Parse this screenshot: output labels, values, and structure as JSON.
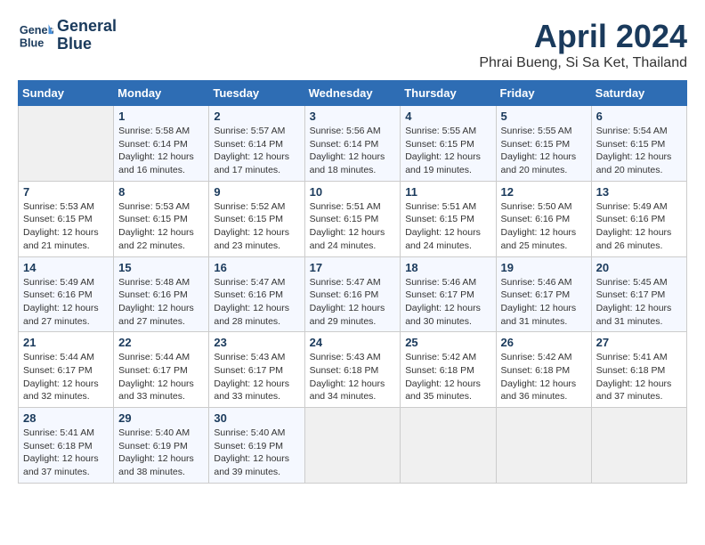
{
  "header": {
    "logo_line1": "General",
    "logo_line2": "Blue",
    "month": "April 2024",
    "location": "Phrai Bueng, Si Sa Ket, Thailand"
  },
  "weekdays": [
    "Sunday",
    "Monday",
    "Tuesday",
    "Wednesday",
    "Thursday",
    "Friday",
    "Saturday"
  ],
  "weeks": [
    [
      {
        "day": "",
        "sunrise": "",
        "sunset": "",
        "daylight": ""
      },
      {
        "day": "1",
        "sunrise": "Sunrise: 5:58 AM",
        "sunset": "Sunset: 6:14 PM",
        "daylight": "Daylight: 12 hours and 16 minutes."
      },
      {
        "day": "2",
        "sunrise": "Sunrise: 5:57 AM",
        "sunset": "Sunset: 6:14 PM",
        "daylight": "Daylight: 12 hours and 17 minutes."
      },
      {
        "day": "3",
        "sunrise": "Sunrise: 5:56 AM",
        "sunset": "Sunset: 6:14 PM",
        "daylight": "Daylight: 12 hours and 18 minutes."
      },
      {
        "day": "4",
        "sunrise": "Sunrise: 5:55 AM",
        "sunset": "Sunset: 6:15 PM",
        "daylight": "Daylight: 12 hours and 19 minutes."
      },
      {
        "day": "5",
        "sunrise": "Sunrise: 5:55 AM",
        "sunset": "Sunset: 6:15 PM",
        "daylight": "Daylight: 12 hours and 20 minutes."
      },
      {
        "day": "6",
        "sunrise": "Sunrise: 5:54 AM",
        "sunset": "Sunset: 6:15 PM",
        "daylight": "Daylight: 12 hours and 20 minutes."
      }
    ],
    [
      {
        "day": "7",
        "sunrise": "Sunrise: 5:53 AM",
        "sunset": "Sunset: 6:15 PM",
        "daylight": "Daylight: 12 hours and 21 minutes."
      },
      {
        "day": "8",
        "sunrise": "Sunrise: 5:53 AM",
        "sunset": "Sunset: 6:15 PM",
        "daylight": "Daylight: 12 hours and 22 minutes."
      },
      {
        "day": "9",
        "sunrise": "Sunrise: 5:52 AM",
        "sunset": "Sunset: 6:15 PM",
        "daylight": "Daylight: 12 hours and 23 minutes."
      },
      {
        "day": "10",
        "sunrise": "Sunrise: 5:51 AM",
        "sunset": "Sunset: 6:15 PM",
        "daylight": "Daylight: 12 hours and 24 minutes."
      },
      {
        "day": "11",
        "sunrise": "Sunrise: 5:51 AM",
        "sunset": "Sunset: 6:15 PM",
        "daylight": "Daylight: 12 hours and 24 minutes."
      },
      {
        "day": "12",
        "sunrise": "Sunrise: 5:50 AM",
        "sunset": "Sunset: 6:16 PM",
        "daylight": "Daylight: 12 hours and 25 minutes."
      },
      {
        "day": "13",
        "sunrise": "Sunrise: 5:49 AM",
        "sunset": "Sunset: 6:16 PM",
        "daylight": "Daylight: 12 hours and 26 minutes."
      }
    ],
    [
      {
        "day": "14",
        "sunrise": "Sunrise: 5:49 AM",
        "sunset": "Sunset: 6:16 PM",
        "daylight": "Daylight: 12 hours and 27 minutes."
      },
      {
        "day": "15",
        "sunrise": "Sunrise: 5:48 AM",
        "sunset": "Sunset: 6:16 PM",
        "daylight": "Daylight: 12 hours and 27 minutes."
      },
      {
        "day": "16",
        "sunrise": "Sunrise: 5:47 AM",
        "sunset": "Sunset: 6:16 PM",
        "daylight": "Daylight: 12 hours and 28 minutes."
      },
      {
        "day": "17",
        "sunrise": "Sunrise: 5:47 AM",
        "sunset": "Sunset: 6:16 PM",
        "daylight": "Daylight: 12 hours and 29 minutes."
      },
      {
        "day": "18",
        "sunrise": "Sunrise: 5:46 AM",
        "sunset": "Sunset: 6:17 PM",
        "daylight": "Daylight: 12 hours and 30 minutes."
      },
      {
        "day": "19",
        "sunrise": "Sunrise: 5:46 AM",
        "sunset": "Sunset: 6:17 PM",
        "daylight": "Daylight: 12 hours and 31 minutes."
      },
      {
        "day": "20",
        "sunrise": "Sunrise: 5:45 AM",
        "sunset": "Sunset: 6:17 PM",
        "daylight": "Daylight: 12 hours and 31 minutes."
      }
    ],
    [
      {
        "day": "21",
        "sunrise": "Sunrise: 5:44 AM",
        "sunset": "Sunset: 6:17 PM",
        "daylight": "Daylight: 12 hours and 32 minutes."
      },
      {
        "day": "22",
        "sunrise": "Sunrise: 5:44 AM",
        "sunset": "Sunset: 6:17 PM",
        "daylight": "Daylight: 12 hours and 33 minutes."
      },
      {
        "day": "23",
        "sunrise": "Sunrise: 5:43 AM",
        "sunset": "Sunset: 6:17 PM",
        "daylight": "Daylight: 12 hours and 33 minutes."
      },
      {
        "day": "24",
        "sunrise": "Sunrise: 5:43 AM",
        "sunset": "Sunset: 6:18 PM",
        "daylight": "Daylight: 12 hours and 34 minutes."
      },
      {
        "day": "25",
        "sunrise": "Sunrise: 5:42 AM",
        "sunset": "Sunset: 6:18 PM",
        "daylight": "Daylight: 12 hours and 35 minutes."
      },
      {
        "day": "26",
        "sunrise": "Sunrise: 5:42 AM",
        "sunset": "Sunset: 6:18 PM",
        "daylight": "Daylight: 12 hours and 36 minutes."
      },
      {
        "day": "27",
        "sunrise": "Sunrise: 5:41 AM",
        "sunset": "Sunset: 6:18 PM",
        "daylight": "Daylight: 12 hours and 37 minutes."
      }
    ],
    [
      {
        "day": "28",
        "sunrise": "Sunrise: 5:41 AM",
        "sunset": "Sunset: 6:18 PM",
        "daylight": "Daylight: 12 hours and 37 minutes."
      },
      {
        "day": "29",
        "sunrise": "Sunrise: 5:40 AM",
        "sunset": "Sunset: 6:19 PM",
        "daylight": "Daylight: 12 hours and 38 minutes."
      },
      {
        "day": "30",
        "sunrise": "Sunrise: 5:40 AM",
        "sunset": "Sunset: 6:19 PM",
        "daylight": "Daylight: 12 hours and 39 minutes."
      },
      {
        "day": "",
        "sunrise": "",
        "sunset": "",
        "daylight": ""
      },
      {
        "day": "",
        "sunrise": "",
        "sunset": "",
        "daylight": ""
      },
      {
        "day": "",
        "sunrise": "",
        "sunset": "",
        "daylight": ""
      },
      {
        "day": "",
        "sunrise": "",
        "sunset": "",
        "daylight": ""
      }
    ]
  ]
}
